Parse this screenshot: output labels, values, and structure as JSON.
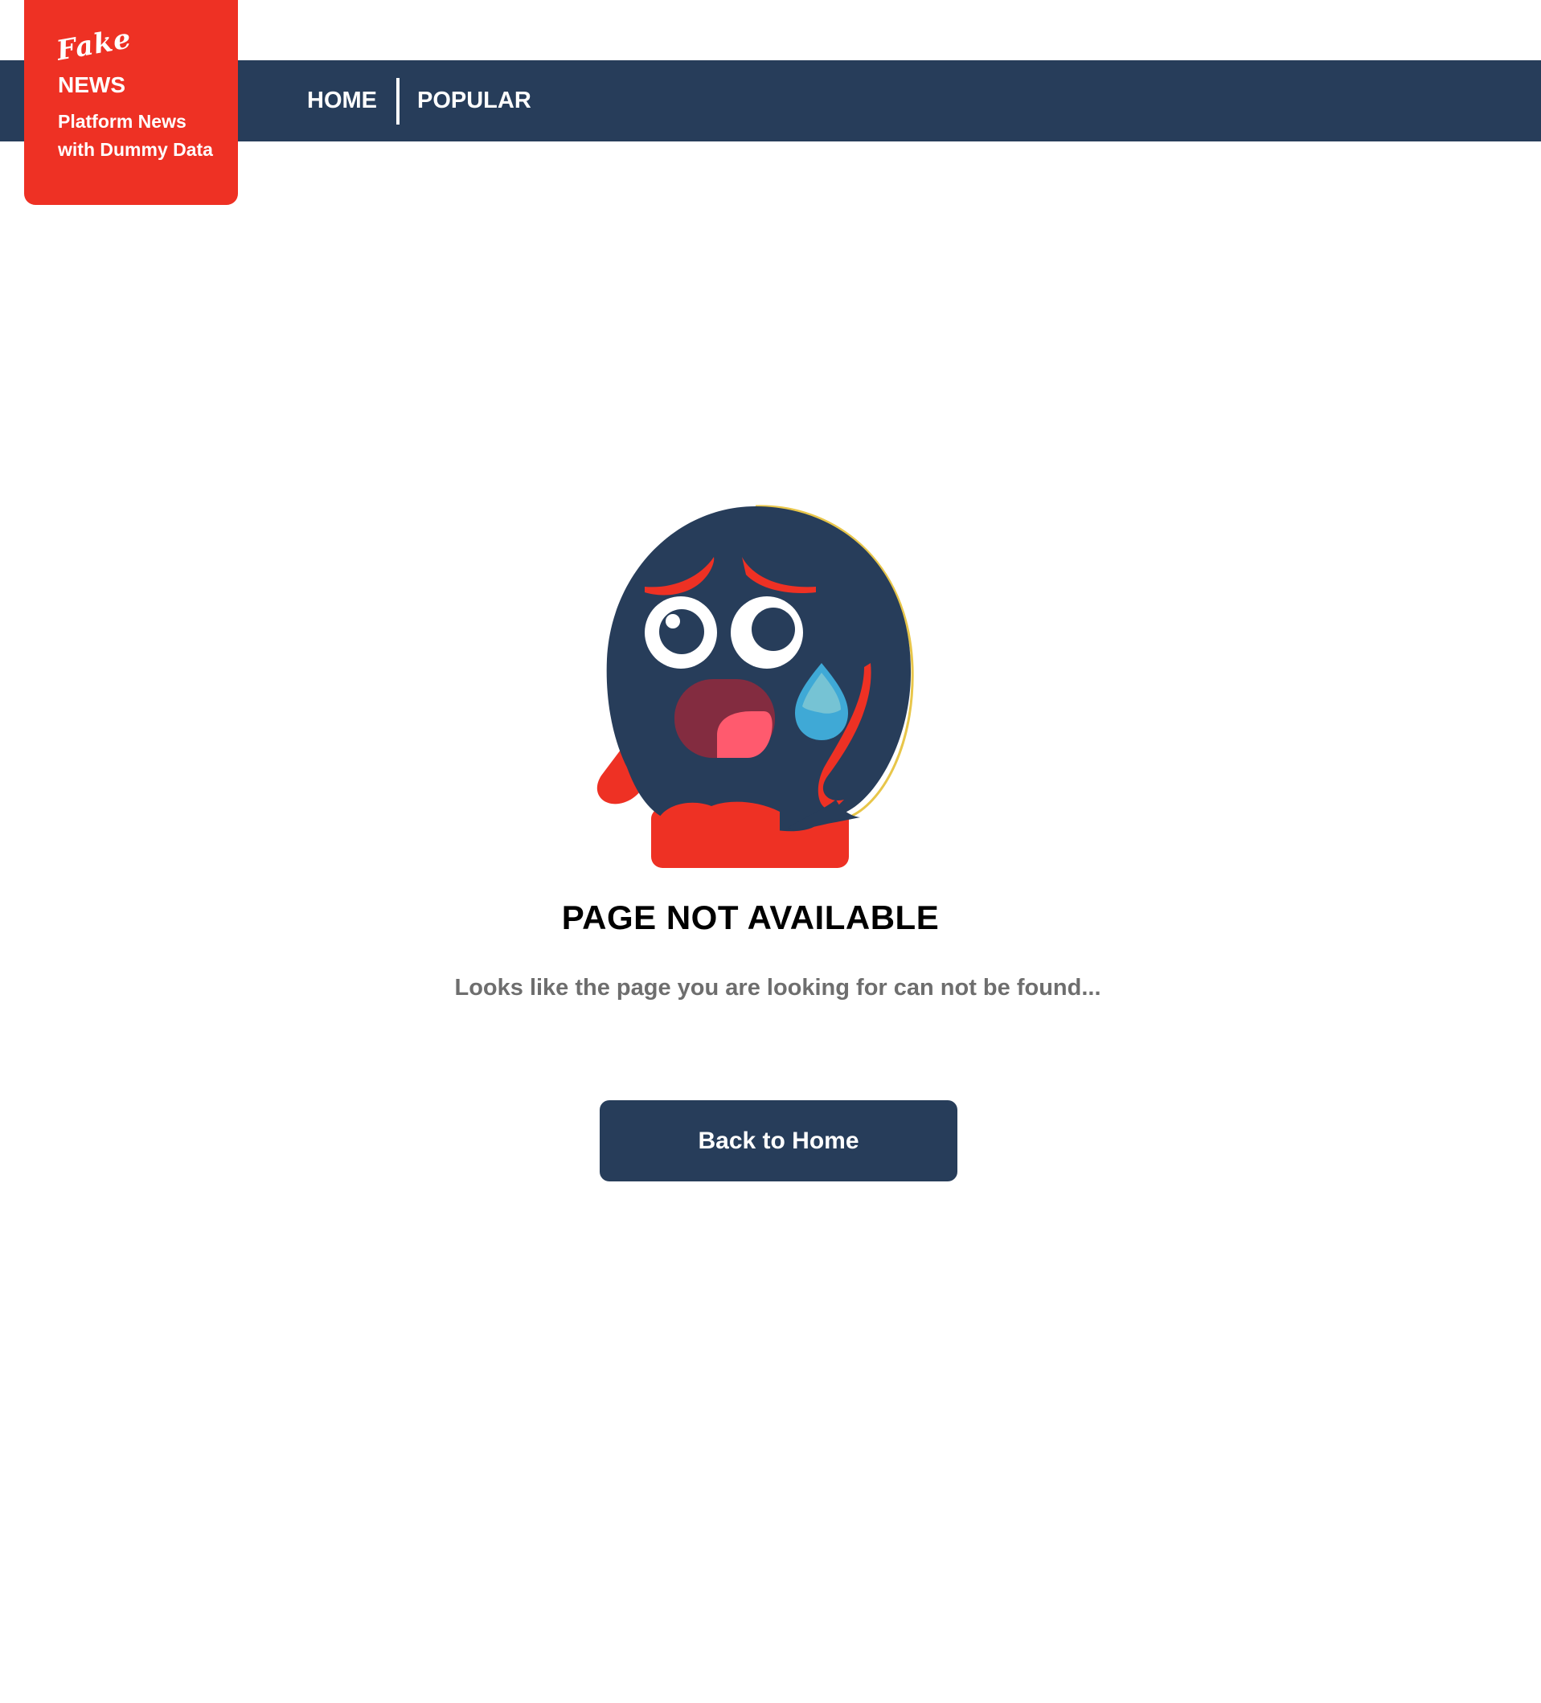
{
  "logo": {
    "script_text": "Fake",
    "title": "NEWS",
    "tagline_line1": "Platform News",
    "tagline_line2": "with Dummy Data"
  },
  "nav": {
    "items": [
      {
        "label": "HOME"
      },
      {
        "label": "POPULAR"
      }
    ]
  },
  "error": {
    "title": "PAGE NOT AVAILABLE",
    "message": "Looks like the page you are looking for can not be found...",
    "button_label": "Back to Home"
  },
  "colors": {
    "navy": "#273d5a",
    "brand_red": "#ee3124",
    "message_gray": "#6e6e6e",
    "tear_blue": "#3fa9d6"
  }
}
